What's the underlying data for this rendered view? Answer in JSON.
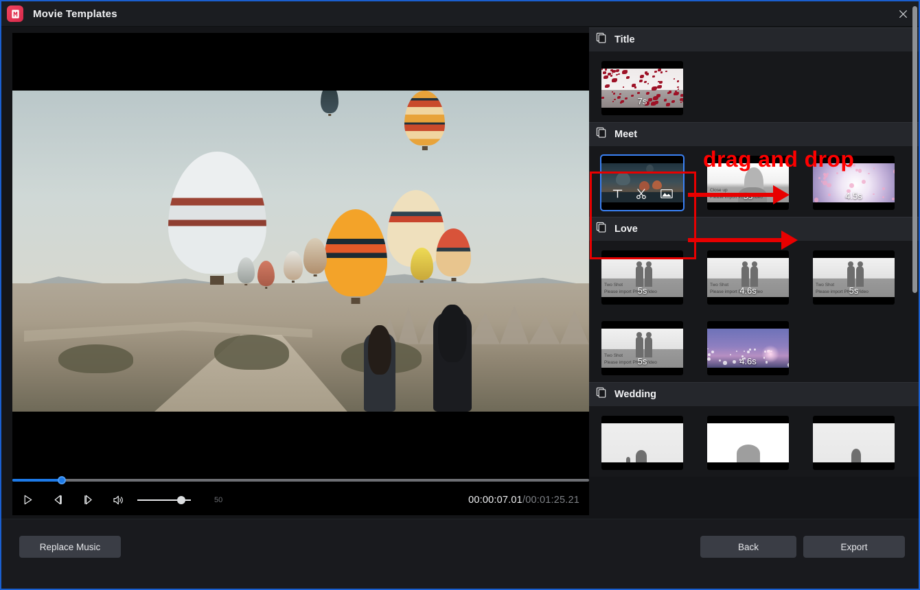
{
  "window": {
    "title": "Movie Templates",
    "logo_icon": "movie-templates-logo",
    "close_icon": "close-icon"
  },
  "preview": {
    "scene_description": "Hot air balloons over Cappadocia valley with two people walking",
    "timeline": {
      "progress_percent": 8.6
    },
    "controls": {
      "play_icon": "play-icon",
      "prev_frame_icon": "previous-frame-icon",
      "next_frame_icon": "next-frame-icon",
      "volume_icon": "volume-icon",
      "volume_value": "50",
      "volume_percent": 82
    },
    "timecode": {
      "current": "00:00:07.01",
      "separator": "/",
      "total": "00:01:25.21"
    }
  },
  "annotations": {
    "drag_and_drop_label": "drag and drop",
    "highlight_color": "#e80000",
    "label_color": "#ff0000"
  },
  "templates": {
    "section_icon": "stack-copy-icon",
    "sections": [
      {
        "name": "Title",
        "items": [
          {
            "duration": "7s",
            "art": "petals",
            "selected": false,
            "caption_line1": "",
            "caption_line2": ""
          }
        ]
      },
      {
        "name": "Meet",
        "items": [
          {
            "duration": "",
            "art": "balloons",
            "selected": true,
            "icons": [
              "text-icon",
              "scissors-icon",
              "image-icon"
            ],
            "caption_line1": "",
            "caption_line2": ""
          },
          {
            "duration": "5s",
            "art": "closeup",
            "selected": false,
            "caption_line1": "Close up",
            "caption_line2": "Please import Photo/Video"
          },
          {
            "duration": "4.5s",
            "art": "blossom",
            "selected": false,
            "caption_line1": "",
            "caption_line2": ""
          }
        ]
      },
      {
        "name": "Love",
        "items": [
          {
            "duration": "5s",
            "art": "two-shot",
            "selected": false,
            "caption_line1": "Two Shot",
            "caption_line2": "Please import Photo/Video"
          },
          {
            "duration": "4.6s",
            "art": "two-shot",
            "selected": false,
            "caption_line1": "Two Shot",
            "caption_line2": "Please import Photo/Video"
          },
          {
            "duration": "5s",
            "art": "two-shot",
            "selected": false,
            "caption_line1": "Two Shot",
            "caption_line2": "Please import Photo/Video"
          },
          {
            "duration": "5s",
            "art": "two-shot",
            "selected": false,
            "caption_line1": "Two Shot",
            "caption_line2": "Please import Photo/Video"
          },
          {
            "duration": "4.6s",
            "art": "blossom-field",
            "selected": false,
            "caption_line1": "",
            "caption_line2": ""
          }
        ]
      },
      {
        "name": "Wedding",
        "items": [
          {
            "duration": "",
            "art": "wedding-a",
            "selected": false,
            "caption_line1": "",
            "caption_line2": ""
          },
          {
            "duration": "",
            "art": "wedding-b",
            "selected": false,
            "caption_line1": "",
            "caption_line2": ""
          },
          {
            "duration": "",
            "art": "wedding-c",
            "selected": false,
            "caption_line1": "",
            "caption_line2": ""
          }
        ]
      }
    ]
  },
  "footer": {
    "replace_music_label": "Replace Music",
    "back_label": "Back",
    "export_label": "Export"
  }
}
